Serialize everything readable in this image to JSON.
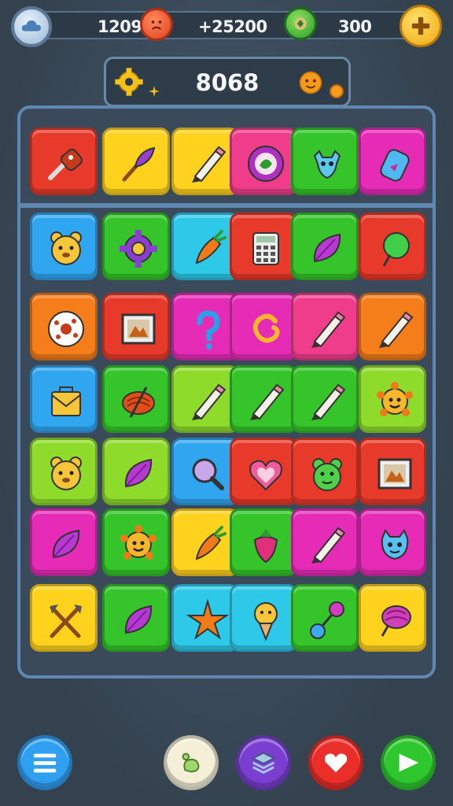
{
  "hud": {
    "resource_1": "1209",
    "resource_2": "+25200",
    "resource_3": "300",
    "score": "8068"
  },
  "colors": {
    "red": "#e83a2a",
    "orange": "#f57d1a",
    "yellow": "#ffd21e",
    "green": "#35c52a",
    "lime": "#8edb2c",
    "blue": "#2fa6ef",
    "cyan": "#2ec9e8",
    "magenta": "#e62bb7",
    "pink": "#ef3d8c"
  },
  "board": {
    "rows": [
      [
        "screwdriver-icon",
        "brush-icon",
        "pencil-icon",
        "badge-leaf-icon",
        "creature-icon",
        "bottle-icon"
      ],
      [
        "bear-icon",
        "gear-icon",
        "carrot-icon",
        "calculator-icon",
        "leaf-icon",
        "balloon-icon"
      ],
      [
        "donut-icon",
        "picture-icon",
        "question-icon",
        "spiral-icon",
        "pencil-icon",
        "pencil-icon"
      ],
      [
        "envelope-bag-icon",
        "basket-icon",
        "pencil-icon",
        "pencil-icon",
        "pencil-icon",
        "sun-face-icon"
      ],
      [
        "bear-icon",
        "leaf-icon",
        "magnifier-icon",
        "heart-icon",
        "frog-icon",
        "picture-icon"
      ],
      [
        "leaf-icon",
        "sun-face-icon",
        "carrot-icon",
        "strawberry-icon",
        "pencil-icon",
        "monster-icon"
      ],
      [
        "crossed-tools-icon",
        "leaf-icon",
        "star-icon",
        "icecream-icon",
        "dumbbell-icon",
        "candy-icon"
      ]
    ],
    "tile_colors": [
      [
        "red",
        "yellow",
        "yellow",
        "pink",
        "green",
        "magenta"
      ],
      [
        "blue",
        "green",
        "cyan",
        "red",
        "green",
        "red"
      ],
      [
        "orange",
        "red",
        "magenta",
        "magenta",
        "pink",
        "orange"
      ],
      [
        "blue",
        "green",
        "lime",
        "green",
        "green",
        "lime"
      ],
      [
        "lime",
        "lime",
        "blue",
        "red",
        "red",
        "red"
      ],
      [
        "magenta",
        "green",
        "yellow",
        "green",
        "magenta",
        "magenta"
      ],
      [
        "yellow",
        "green",
        "cyan",
        "cyan",
        "green",
        "yellow"
      ]
    ]
  },
  "bottom_bar": [
    "menu-icon",
    "hint-icon",
    "layers-icon",
    "heart-icon",
    "play-icon"
  ]
}
